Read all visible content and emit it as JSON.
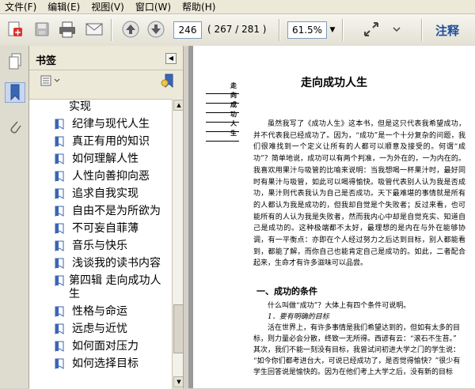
{
  "menubar": {
    "items": [
      "文件(F)",
      "编辑(E)",
      "视图(V)",
      "窗口(W)",
      "帮助(H)"
    ]
  },
  "toolbar": {
    "page_current": "246",
    "page_count": "( 267 / 281 )",
    "zoom": "61.5%",
    "annotate_label": "注释"
  },
  "bookmarks_panel": {
    "title": "书签",
    "items": [
      {
        "label": "实现",
        "partial": true
      },
      {
        "label": "纪律与现代人生"
      },
      {
        "label": "真正有用的知识"
      },
      {
        "label": "如何理解人性"
      },
      {
        "label": "人性向善抑向恶"
      },
      {
        "label": "追求自我实现"
      },
      {
        "label": "自由不是为所欲为"
      },
      {
        "label": "不可妄自菲薄"
      },
      {
        "label": "音乐与快乐"
      },
      {
        "label": "浅谈我的读书内容"
      },
      {
        "label": "第四辑 走向成功人生",
        "level": 1
      },
      {
        "label": "性格与命运"
      },
      {
        "label": "远虑与近忧"
      },
      {
        "label": "如何面对压力"
      },
      {
        "label": "如何选择目标"
      }
    ]
  },
  "document": {
    "side_title": "走向成功人生",
    "chapter_title": "走向成功人生",
    "paragraph1": "虽然我写了《成功人生》这本书，但是这只代表我希望成功，并不代表我已经成功了。因为，“成功”是一个十分复杂的问题，我们很难找到一个定义让所有的人都可以顺意及接受的。何谓“成功”？简单地说，成功可以有两个判准，一为外在的，一为内在的。我喜欢用果汁与吸管的比喻来说明：当我想喝一杯果汁时，最好同时有果汁与吸管，如此可以喝得愉快。吸管代表别人认为我是否成功，果汁则代表我认为自己是否成功。天下最难堪的事情就是所有的人都认为我是成功的，但我却自觉是个失败者；反过来看，也可能所有的人认为我是失败者，然而我内心中却是自觉充实、知道自己是成功的。这种极端都不太好，最理想的是内在与外在能够协调，有一平衡点：亦即在个人经过努力之后达到目标，别人都能看到，都能了解，而你自己也能肯定自己是成功的。如此，二者配合起来，生命才有许多滋味可以品尝。",
    "section1_title": "一、成功的条件",
    "line_question": "什么叫做“成功”？大体上有四个条件可说明。",
    "subhead1": "1．要有明确的目标",
    "line_a": "活在世界上，有许多事情是我们希望达到的，但如有太多的目",
    "line_b": "标，则力量必会分散，终致一无所得。西谚有云：“滚石不生苔。”",
    "line_c": "其次，我们不能一刻没有目标，我曾试问初进大学之门的学生说：",
    "line_d": "“如今你们都考进台大，可说已经成功了，是否觉得愉快？”很少有",
    "line_e": "学生回答说是愉快的。因为在他们考上大学之后，没有新的目标"
  }
}
